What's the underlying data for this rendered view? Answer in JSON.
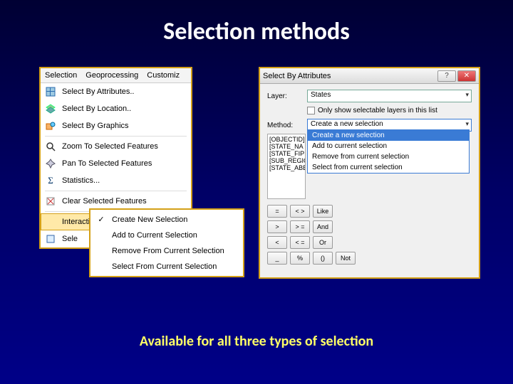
{
  "title": "Selection methods",
  "caption": "Available for all three types of selection",
  "menu1": {
    "menubar": [
      "Selection",
      "Geoprocessing",
      "Customiz"
    ],
    "items": [
      {
        "label": "Select By Attributes..",
        "icon": "attr"
      },
      {
        "label": "Select By Location..",
        "icon": "loc"
      },
      {
        "label": "Select By Graphics",
        "icon": "graph"
      },
      {
        "sep": true
      },
      {
        "label": "Zoom To Selected Features",
        "icon": "zoom"
      },
      {
        "label": "Pan To Selected Features",
        "icon": "pan"
      },
      {
        "label": "Statistics...",
        "icon": "sigma"
      },
      {
        "sep": true
      },
      {
        "label": "Clear Selected Features",
        "icon": "clear"
      },
      {
        "sep": true
      },
      {
        "label": "Interactive Selection Method",
        "highlight": true,
        "submenu": true
      },
      {
        "label": "Sele",
        "icon": "opts",
        "truncated": true
      }
    ]
  },
  "submenu": {
    "items": [
      {
        "label": "Create New Selection",
        "checked": true
      },
      {
        "label": "Add to Current Selection"
      },
      {
        "label": "Remove From Current Selection"
      },
      {
        "label": "Select From Current Selection"
      }
    ]
  },
  "dialog": {
    "title": "Select By Attributes",
    "layer_label": "Layer:",
    "layer_value": "States",
    "only_selectable": "Only show selectable layers in this list",
    "method_label": "Method:",
    "method_value": "Create a new selection",
    "method_options": [
      "Create a new selection",
      "Add to current selection",
      "Remove from current selection",
      "Select from current selection"
    ],
    "fields": [
      "[OBJECTID]",
      "[STATE_NA",
      "[STATE_FIP",
      "[SUB_REGION]",
      "[STATE_ABBR]"
    ],
    "ops": [
      "=",
      "< >",
      "Like",
      ">",
      "> =",
      "And",
      "<",
      "< =",
      "Or",
      "_",
      "%",
      "()",
      "Not"
    ]
  }
}
